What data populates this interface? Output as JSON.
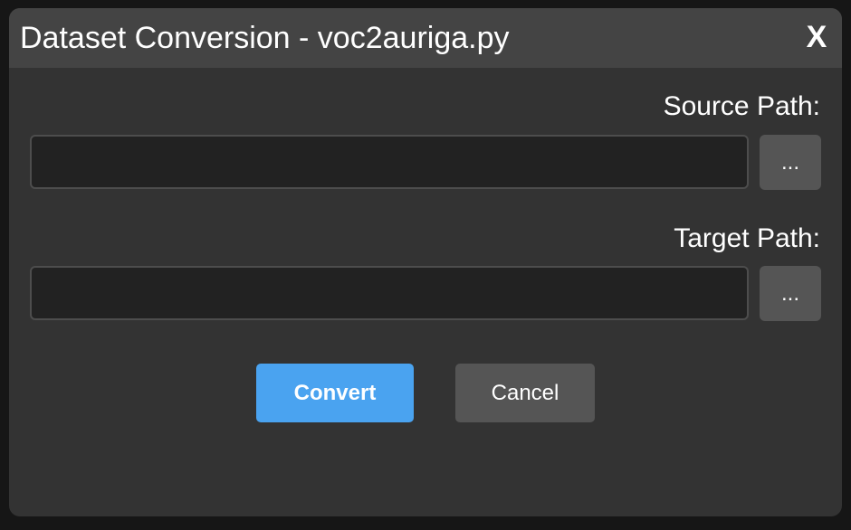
{
  "dialog": {
    "title": "Dataset Conversion - voc2auriga.py",
    "close_label": "X"
  },
  "source": {
    "label": "Source Path:",
    "value": "",
    "browse_label": "..."
  },
  "target": {
    "label": "Target Path:",
    "value": "",
    "browse_label": "..."
  },
  "actions": {
    "convert_label": "Convert",
    "cancel_label": "Cancel"
  },
  "colors": {
    "accent": "#4aa3f0",
    "dialog_bg": "#333333",
    "titlebar_bg": "#444444"
  }
}
